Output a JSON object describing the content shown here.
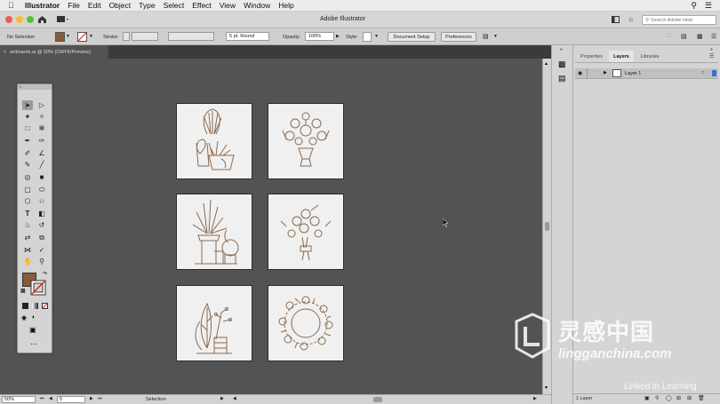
{
  "menubar": {
    "items": [
      "Illustrator",
      "File",
      "Edit",
      "Object",
      "Type",
      "Select",
      "Effect",
      "View",
      "Window",
      "Help"
    ]
  },
  "appbar": {
    "title": "Adobe Illustrator",
    "search_placeholder": "Search Adobe Help"
  },
  "controlbar": {
    "selection_label": "No Selection",
    "stroke_label": "Stroke:",
    "brush": "5 pt. Round",
    "opacity_label": "Opacity:",
    "opacity_value": "100%",
    "style_label": "Style:",
    "doc_setup": "Document Setup",
    "preferences": "Preferences"
  },
  "document": {
    "tab_label": "artboards.ai @ 50% (CMYK/Preview)"
  },
  "status": {
    "zoom": "50%",
    "artboard_num": "5",
    "tool": "Selection"
  },
  "panel": {
    "tabs": [
      "Properties",
      "Layers",
      "Libraries"
    ],
    "active_tab": "Layers",
    "layer_name": "Layer 1",
    "layer_count": "1 Layer"
  },
  "watermark": {
    "brand": "灵感中国",
    "url": "lingganchina.com",
    "linkedin": "Linked in Learning"
  },
  "colors": {
    "fill": "#8a5a3a",
    "accent_blue": "#3b6fd1",
    "line_art": "#8b6a4f",
    "canvas": "#535353"
  }
}
